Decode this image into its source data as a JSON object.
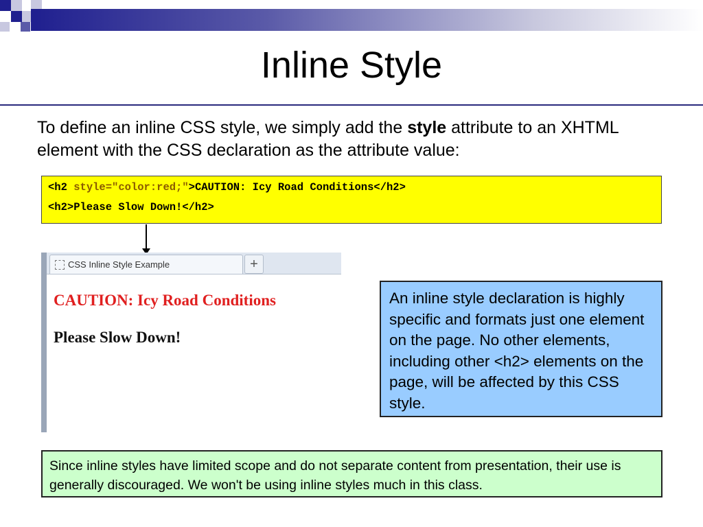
{
  "slide": {
    "title": "Inline Style",
    "intro": {
      "before": "To define an inline CSS style, we simply add the ",
      "bold": "style",
      "after": " attribute to an XHTML element with the CSS declaration as the attribute value:"
    },
    "code": {
      "line1_open": "<h2 ",
      "line1_attr": "style=\"color:red;\"",
      "line1_rest": ">CAUTION: Icy Road Conditions</h2>",
      "line2": "<h2>Please Slow Down!</h2>"
    },
    "browser": {
      "tab_label": "CSS Inline Style Example",
      "new_tab_symbol": "+",
      "heading_red": "CAUTION: Icy Road Conditions",
      "heading_plain": "Please Slow Down!"
    },
    "note": "An inline style declaration is highly specific and formats just one element on the page.  No other elements, including other <h2> elements on the page, will be affected by this CSS style.",
    "footer": "Since inline styles have limited scope and do not separate content from presentation, their use is generally discouraged.  We won't be using inline styles much in this class."
  },
  "colors": {
    "title_rule": "#28287c",
    "code_background": "#ffff00",
    "note_background": "#99ccff",
    "footer_background": "#ccffcc",
    "caution_red": "#e02020"
  }
}
